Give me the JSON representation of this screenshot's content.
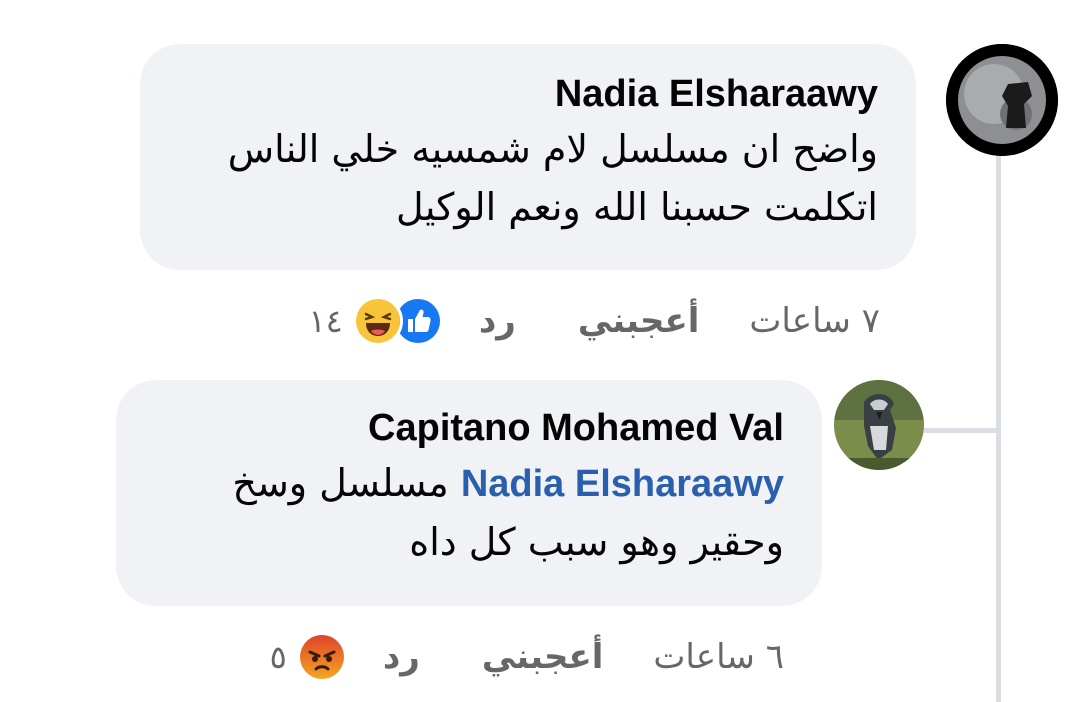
{
  "thread": {
    "comments": [
      {
        "author": "Nadia Elsharaawy",
        "text_line1": "واضح ان مسلسل لام شمسيه خلي الناس",
        "text_line2": "اتكلمت حسبنا الله ونعم الوكيل",
        "time": "٧ ساعات",
        "like_label": "أعجبني",
        "reply_label": "رد",
        "reactions": [
          "like-icon",
          "haha-icon"
        ],
        "reaction_count": "١٤"
      },
      {
        "author": "Capitano Mohamed Val",
        "mention": "Nadia Elsharaawy",
        "text_line1_rest": "مسلسل وسخ",
        "text_line2": "وحقير وهو سبب كل داه",
        "time": "٦ ساعات",
        "like_label": "أعجبني",
        "reply_label": "رد",
        "reactions": [
          "angry-icon"
        ],
        "reaction_count": "٥"
      }
    ]
  },
  "colors": {
    "bubble": "#f0f2f5",
    "text": "#050505",
    "meta": "#65676b",
    "mention": "#2a5fad",
    "like_blue": "#1877f2",
    "haha_yellow": "#f7c43a",
    "angry_red": "#e9710f"
  }
}
